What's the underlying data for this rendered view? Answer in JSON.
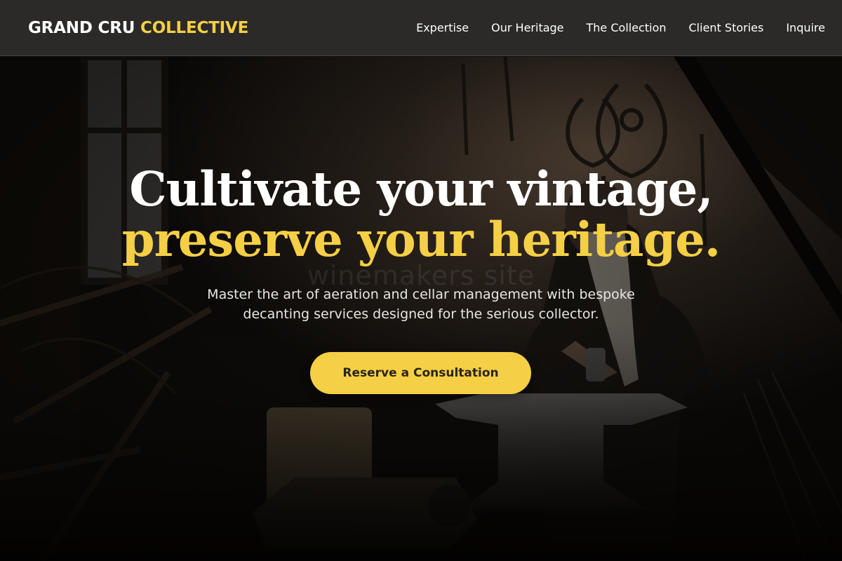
{
  "brand": {
    "name_primary": "GRAND CRU",
    "name_accent": "COLLECTIVE"
  },
  "nav": {
    "items": [
      {
        "label": "Expertise"
      },
      {
        "label": "Our Heritage"
      },
      {
        "label": "The Collection"
      },
      {
        "label": "Client Stories"
      },
      {
        "label": "Inquire"
      }
    ]
  },
  "hero": {
    "headline_line1": "Cultivate your vintage,",
    "headline_line2": "preserve your heritage.",
    "watermark": "winemakers site",
    "subtitle": "Master the art of aeration and cellar management with bespoke decanting services designed for the serious collector.",
    "cta_label": "Reserve a Consultation"
  },
  "colors": {
    "accent": "#f5cf45",
    "header_bg": "#2b2a29",
    "text_light": "#ffffff"
  }
}
